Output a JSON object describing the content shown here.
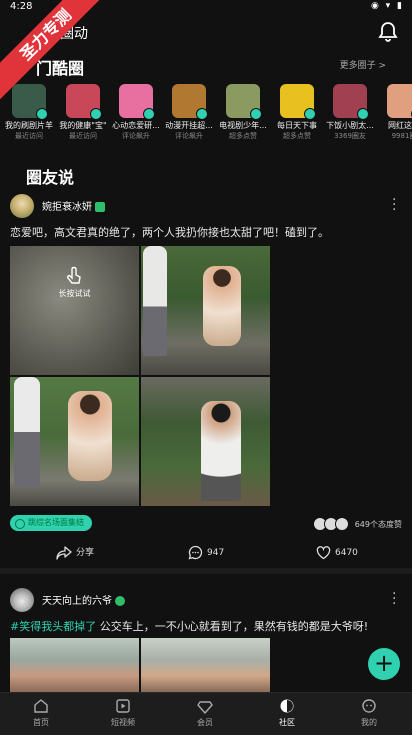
{
  "status": {
    "time": "4:28",
    "icons": "◉ ▾ ▮"
  },
  "banner": "圣力专测",
  "header": {
    "title": "圈动"
  },
  "hot": {
    "title": "门酷圈",
    "more": "更多圈子 >",
    "circles": [
      {
        "name": "我的刷剧片羊",
        "sub": "最近访问",
        "color": "#3a5a4a"
      },
      {
        "name": "我的健康\"宝\"",
        "sub": "最近访问",
        "color": "#c8485a"
      },
      {
        "name": "心动恋爱研...",
        "sub": "评论飙升",
        "color": "#e870a0"
      },
      {
        "name": "动漫开挂超...",
        "sub": "评论飙升",
        "color": "#b07830"
      },
      {
        "name": "电视剧少年...",
        "sub": "超多点赞",
        "color": "#8a9a60"
      },
      {
        "name": "每日天下事",
        "sub": "超多点赞",
        "color": "#e8c020"
      },
      {
        "name": "下饭小剧太...",
        "sub": "3369圈友",
        "color": "#a04050"
      },
      {
        "name": "网红这个",
        "sub": "9981圈",
        "color": "#e0a080"
      }
    ]
  },
  "feed": {
    "section_title": "圈友说",
    "post1": {
      "user": "婉拒衰冰妍",
      "text": "恋爱吧，高文君真的绝了，两个人我扔你接也太甜了吧！磕到了。",
      "longpress": "长按试试",
      "tag": "跳综名场面集结",
      "reactions": "649个态度赞",
      "share": "分享",
      "comments": "947",
      "likes": "6470"
    },
    "post2": {
      "user": "天天向上的六爷",
      "hashtag": "#笑得我头都掉了",
      "text": " 公交车上，一不小心就看到了，果然有钱的都是大爷呀!"
    }
  },
  "fab": "+",
  "tabs": [
    {
      "label": "首页"
    },
    {
      "label": "短视频"
    },
    {
      "label": "会员"
    },
    {
      "label": "社区"
    },
    {
      "label": "我的"
    }
  ]
}
